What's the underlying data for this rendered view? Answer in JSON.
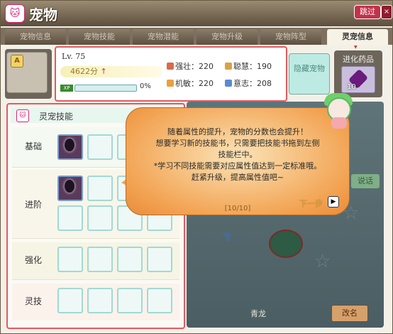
{
  "window": {
    "title": "宠物",
    "skip_label": "跳过",
    "close_label": "×"
  },
  "tabs": [
    {
      "label": "宠物信息"
    },
    {
      "label": "宠物技能"
    },
    {
      "label": "宠物潜能"
    },
    {
      "label": "宠物升级"
    },
    {
      "label": "宠物阵型"
    },
    {
      "label": "灵宠信息"
    }
  ],
  "pet": {
    "grade": "A",
    "level": "Lv. 75",
    "score": "4622分",
    "xp_label": "XP",
    "xp_percent": "0%",
    "xp_fill": 0.0,
    "name": "青龙",
    "rename_label": "改名"
  },
  "stats": [
    {
      "label": "强壮",
      "value": "220",
      "color": "#d96a4a"
    },
    {
      "label": "聪慧",
      "value": "190",
      "color": "#d8a24a"
    },
    {
      "label": "机敏",
      "value": "220",
      "color": "#e8a040"
    },
    {
      "label": "意志",
      "value": "208",
      "color": "#5a8ad0"
    }
  ],
  "hidden_pet": {
    "label": "隐藏宠物"
  },
  "medicine": {
    "label": "进化药品",
    "count": "10"
  },
  "skills": {
    "title": "灵宠技能",
    "rows": [
      {
        "label": "基础"
      },
      {
        "label": "进阶"
      },
      {
        "label": "强化"
      },
      {
        "label": "灵技"
      }
    ]
  },
  "tooltip": {
    "lines": [
      "随着属性的提升，宠物的分数也会提升！",
      "想要学习新的技能书，只需要把技能书拖到左侧",
      "技能栏中。",
      "*学习不同技能需要对应属性值达到一定标准哦。",
      "赶紧升级，提高属性值吧~"
    ],
    "progress": "[10/10]",
    "next_label": "下一步",
    "side_label": "说话"
  }
}
